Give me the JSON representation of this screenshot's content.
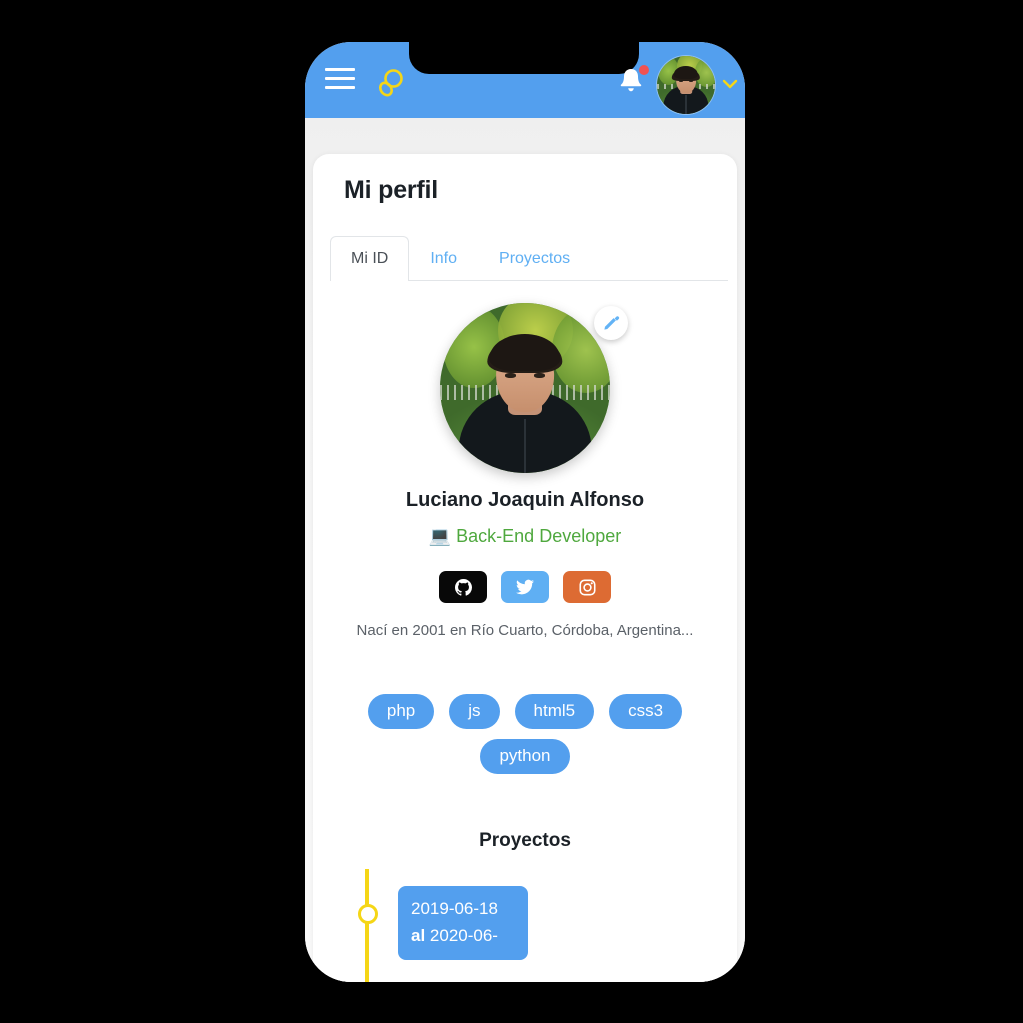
{
  "app_bar": {
    "menu_icon": "hamburger-icon",
    "search_icon": "search-icon",
    "bell_icon": "bell-icon",
    "has_notification": true,
    "avatar_icon": "user-avatar",
    "chevron_icon": "chevron-down-icon",
    "background_color": "#539FEE",
    "accent_color": "#F5D616"
  },
  "page": {
    "title": "Mi perfil"
  },
  "tabs": [
    {
      "label": "Mi ID",
      "active": true
    },
    {
      "label": "Info",
      "active": false
    },
    {
      "label": "Proyectos",
      "active": false
    }
  ],
  "profile": {
    "edit_icon": "pencil-icon",
    "name": "Luciano Joaquin Alfonso",
    "role_emoji": "💻",
    "role": "Back-End Developer",
    "role_color": "#4FA83E",
    "bio": "Nací en 2001 en Río Cuarto, Córdoba, Argentina...",
    "social": [
      {
        "name": "github",
        "icon": "github-icon",
        "color": "#080808"
      },
      {
        "name": "twitter",
        "icon": "twitter-icon",
        "color": "#5FAFF3"
      },
      {
        "name": "instagram",
        "icon": "instagram-icon",
        "color": "#DD6B33"
      }
    ],
    "skills": [
      "php",
      "js",
      "html5",
      "css3",
      "python"
    ]
  },
  "projects": {
    "title": "Proyectos",
    "timeline_color": "#F5D616",
    "items": [
      {
        "start_date": "2019-06-18",
        "connector": "al",
        "end_date": "2020-06-"
      }
    ]
  }
}
